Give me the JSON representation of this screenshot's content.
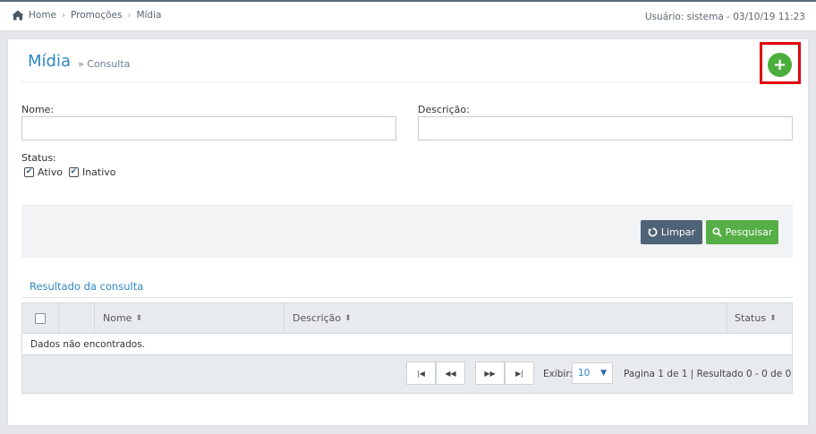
{
  "breadcrumb": {
    "home": "Home",
    "promocoes": "Promoções",
    "midia": "Mídia"
  },
  "user_info": "Usuário: sistema - 03/10/19 11:23",
  "page": {
    "title": "Mídia",
    "subtitle": "» Consulta"
  },
  "form": {
    "nome_label": "Nome:",
    "nome_value": "",
    "descricao_label": "Descrição:",
    "descricao_value": "",
    "status_label": "Status:",
    "ativo_label": "Ativo",
    "inativo_label": "Inativo",
    "ativo_checked": true,
    "inativo_checked": true
  },
  "buttons": {
    "limpar": "Limpar",
    "pesquisar": "Pesquisar",
    "add": "+"
  },
  "results": {
    "title": "Resultado da consulta",
    "columns": [
      "Nome",
      "Descrição",
      "Status"
    ],
    "empty_message": "Dados não encontrados."
  },
  "pager": {
    "first": "|◀",
    "prev": "◀◀",
    "next": "▶▶",
    "last": "▶|",
    "exibir_label": "Exibir:",
    "page_size": "10",
    "info": "Pagina 1 de 1 | Resultado 0 - 0 de 0"
  },
  "icons": {
    "home": "home-icon",
    "add": "plus-icon",
    "limpar": "refresh-icon",
    "pesquisar": "search-icon"
  },
  "colors": {
    "accent": "#2e86c1",
    "add_button": "#4cae3c",
    "highlight": "#e3000f",
    "limpar_button": "#4f6377",
    "pesquisar_button": "#55ae46"
  }
}
